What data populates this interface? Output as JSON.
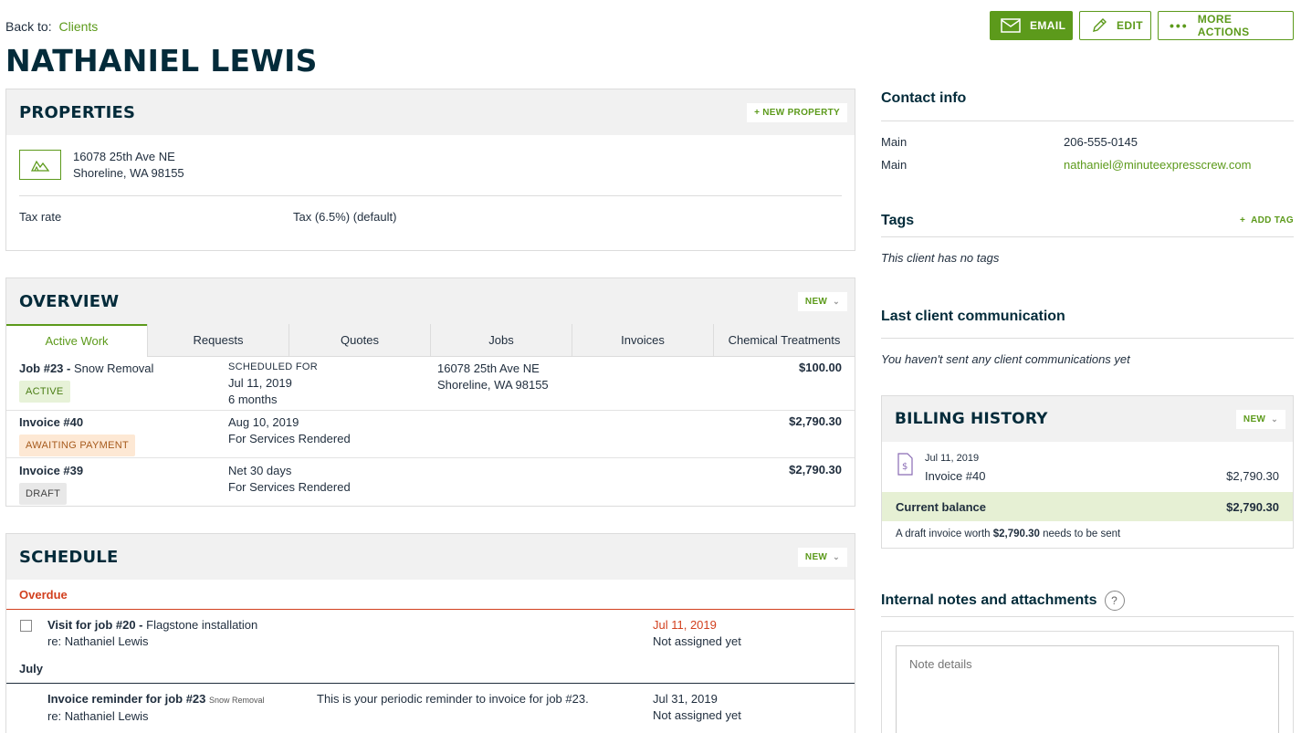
{
  "header": {
    "back_label": "Back to:",
    "back_link": "Clients",
    "client_name": "NATHANIEL LEWIS",
    "actions": {
      "email": "EMAIL",
      "edit": "EDIT",
      "more": "MORE ACTIONS"
    }
  },
  "properties": {
    "title": "PROPERTIES",
    "new_button": "+ NEW PROPERTY",
    "address_line1": "16078 25th Ave NE",
    "address_line2": "Shoreline, WA 98155",
    "tax_label": "Tax rate",
    "tax_value": "Tax (6.5%) (default)"
  },
  "overview": {
    "title": "OVERVIEW",
    "new_button": "NEW",
    "tabs": [
      "Active Work",
      "Requests",
      "Quotes",
      "Jobs",
      "Invoices",
      "Chemical Treatments"
    ],
    "rows": [
      {
        "title_bold": "Job #23 -",
        "title_rest": "Snow Removal",
        "badge": "ACTIVE",
        "col2_line1": "SCHEDULED FOR",
        "col2_line2": "Jul 11, 2019",
        "col2_line3": "6 months",
        "col3_line1": "16078 25th Ave NE",
        "col3_line2": "Shoreline, WA 98155",
        "amount": "$100.00"
      },
      {
        "title_bold": "Invoice #40",
        "badge": "AWAITING PAYMENT",
        "col2_line1": "Aug 10, 2019",
        "col2_line2": "For Services Rendered",
        "amount": "$2,790.30"
      },
      {
        "title_bold": "Invoice #39",
        "badge": "DRAFT",
        "col2_line1": "Net 30 days",
        "col2_line2": "For Services Rendered",
        "amount": "$2,790.30"
      }
    ]
  },
  "schedule": {
    "title": "SCHEDULE",
    "new_button": "NEW",
    "overdue_label": "Overdue",
    "overdue_item": {
      "title_bold": "Visit for job #20 -",
      "title_rest": "Flagstone installation",
      "re": "re: Nathaniel Lewis",
      "date": "Jul 11, 2019",
      "assigned": "Not assigned yet"
    },
    "july_label": "July",
    "july_item": {
      "title_bold": "Invoice reminder for job #23",
      "title_small": "Snow Removal",
      "re": "re: Nathaniel Lewis",
      "description": "This is your periodic reminder to invoice for job #23.",
      "date": "Jul 31, 2019",
      "assigned": "Not assigned yet"
    }
  },
  "contact": {
    "title": "Contact info",
    "rows": [
      {
        "label": "Main",
        "value": "206-555-0145"
      },
      {
        "label": "Main",
        "value": "nathaniel@minuteexpresscrew.com"
      }
    ]
  },
  "tags": {
    "title": "Tags",
    "add_button": "ADD TAG",
    "empty": "This client has no tags"
  },
  "communication": {
    "title": "Last client communication",
    "empty": "You haven't sent any client communications yet"
  },
  "billing": {
    "title": "BILLING HISTORY",
    "new_button": "NEW",
    "item_date": "Jul 11, 2019",
    "item_label": "Invoice #40",
    "item_amount": "$2,790.30",
    "balance_label": "Current balance",
    "balance_amount": "$2,790.30",
    "note_prefix": "A draft invoice worth",
    "note_amount": "$2,790.30",
    "note_suffix": "needs to be sent"
  },
  "notes": {
    "title": "Internal notes and attachments",
    "help": "?",
    "placeholder": "Note details"
  },
  "colors": {
    "brand_green": "#5c9a1b",
    "overdue_red": "#d2401f",
    "heading_navy": "#032b3a"
  }
}
